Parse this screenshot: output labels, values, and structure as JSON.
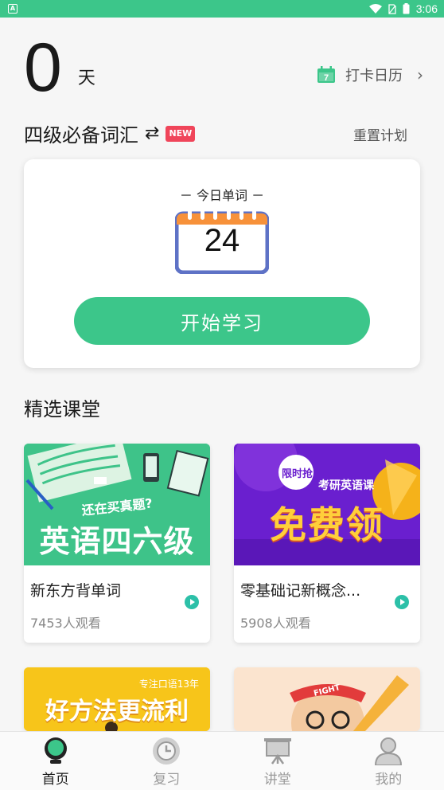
{
  "status_bar": {
    "time": "3:06",
    "left_badge": "A"
  },
  "streak": {
    "count": "0",
    "unit": "天"
  },
  "checkin": {
    "calendar_day": "7",
    "label": "打卡日历"
  },
  "plan": {
    "title": "四级必备词汇",
    "new_badge": "NEW",
    "reset_label": "重置计划"
  },
  "today_card": {
    "label": "－ 今日单词 －",
    "word_count": "24",
    "start_button": "开始学习"
  },
  "section_title": "精选课堂",
  "courses": [
    {
      "title": "新东方背单词",
      "views": "7453人观看",
      "banner_sub": "还在买真题?",
      "banner_main": "英语四六级",
      "colors": {
        "bg": "#3ec389"
      }
    },
    {
      "title": "零基础记新概念...",
      "views": "5908人观看",
      "banner_badge": "限时抢",
      "banner_sub": "考研英语课",
      "banner_main": "免费领",
      "colors": {
        "bg": "#7a2bd6"
      }
    },
    {
      "banner_sub": "专注口语13年",
      "banner_main": "好方法更流利",
      "colors": {
        "bg": "#f7c51a"
      }
    },
    {
      "banner_badge": "FIGHT",
      "colors": {
        "bg": "#fbe4cf"
      }
    }
  ],
  "bottom_nav": [
    {
      "label": "首页",
      "icon": "home-bulb-icon",
      "active": true
    },
    {
      "label": "复习",
      "icon": "clock-icon",
      "active": false
    },
    {
      "label": "讲堂",
      "icon": "easel-icon",
      "active": false
    },
    {
      "label": "我的",
      "icon": "person-icon",
      "active": false
    }
  ],
  "colors": {
    "accent": "#3cc68a",
    "new_badge": "#f0455a",
    "calendar_top": "#f7913a",
    "calendar_frame": "#5e72c6"
  }
}
